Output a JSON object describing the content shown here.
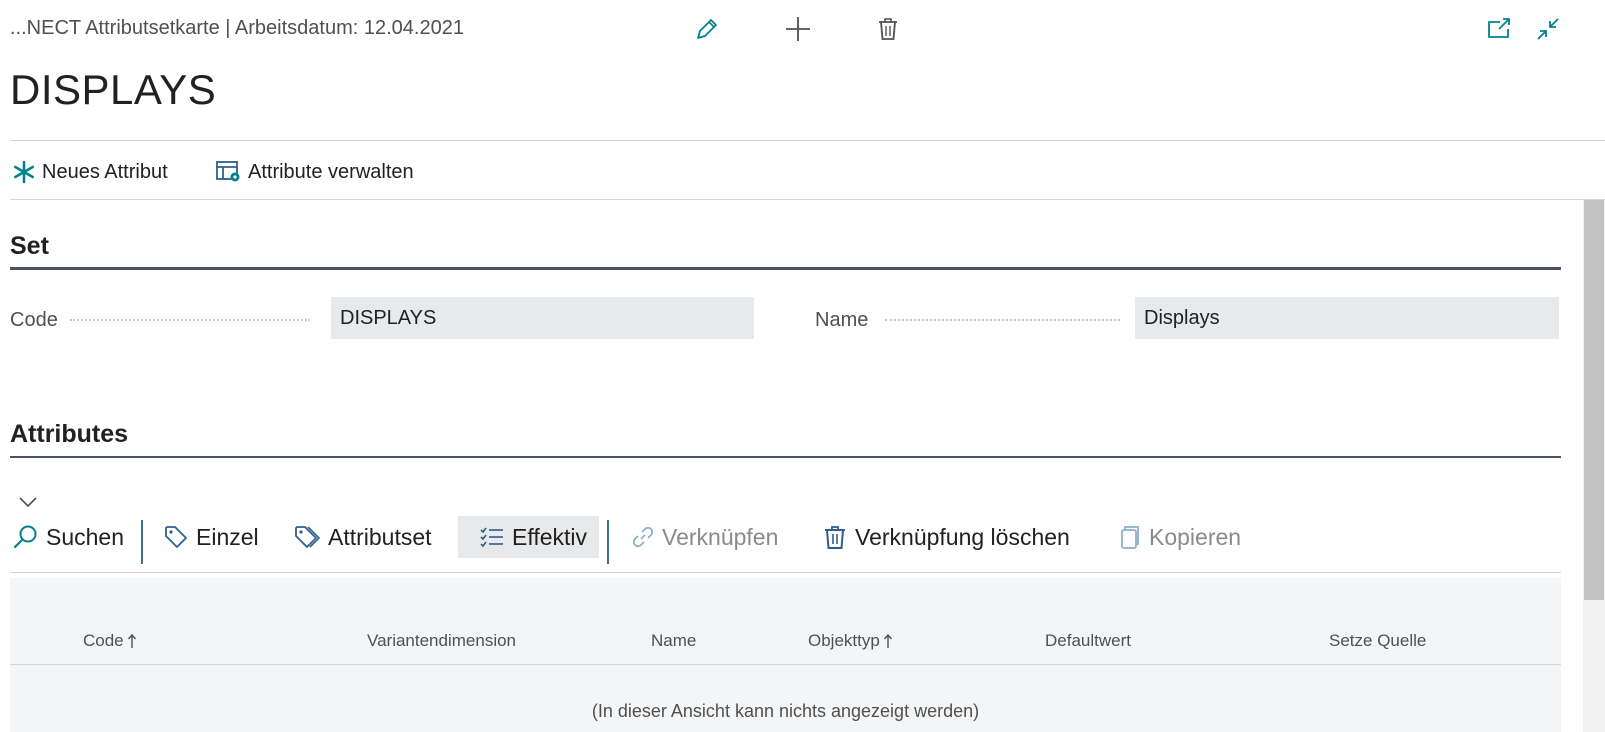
{
  "header": {
    "breadcrumb": "...NECT Attributsetkarte | Arbeitsdatum: 12.04.2021",
    "title": "DISPLAYS",
    "icons": [
      "edit-icon",
      "add-icon",
      "delete-icon",
      "open-new-window-icon",
      "collapse-icon"
    ]
  },
  "actions": {
    "new_attribute": "Neues Attribut",
    "manage_attributes": "Attribute verwalten"
  },
  "set_section": {
    "title": "Set",
    "code_label": "Code",
    "code_value": "DISPLAYS",
    "name_label": "Name",
    "name_value": "Displays"
  },
  "attributes_section": {
    "title": "Attributes",
    "toolbar": {
      "search": "Suchen",
      "single": "Einzel",
      "attribute_set": "Attributset",
      "effective": "Effektiv",
      "link": "Verknüpfen",
      "delete_link": "Verknüpfung löschen",
      "copy": "Kopieren"
    },
    "columns": [
      "Code",
      "Variantendimension",
      "Name",
      "Objekttyp",
      "Defaultwert",
      "Setze Quelle"
    ],
    "empty_message": "(In dieser Ansicht kann nichts angezeigt werden)"
  },
  "colors": {
    "accent": "#00838f",
    "icon_dark": "#2f5f8f",
    "section_rule": "#4a5366",
    "field_bg": "#e8e9ea",
    "separator": "#3e6e8e"
  }
}
